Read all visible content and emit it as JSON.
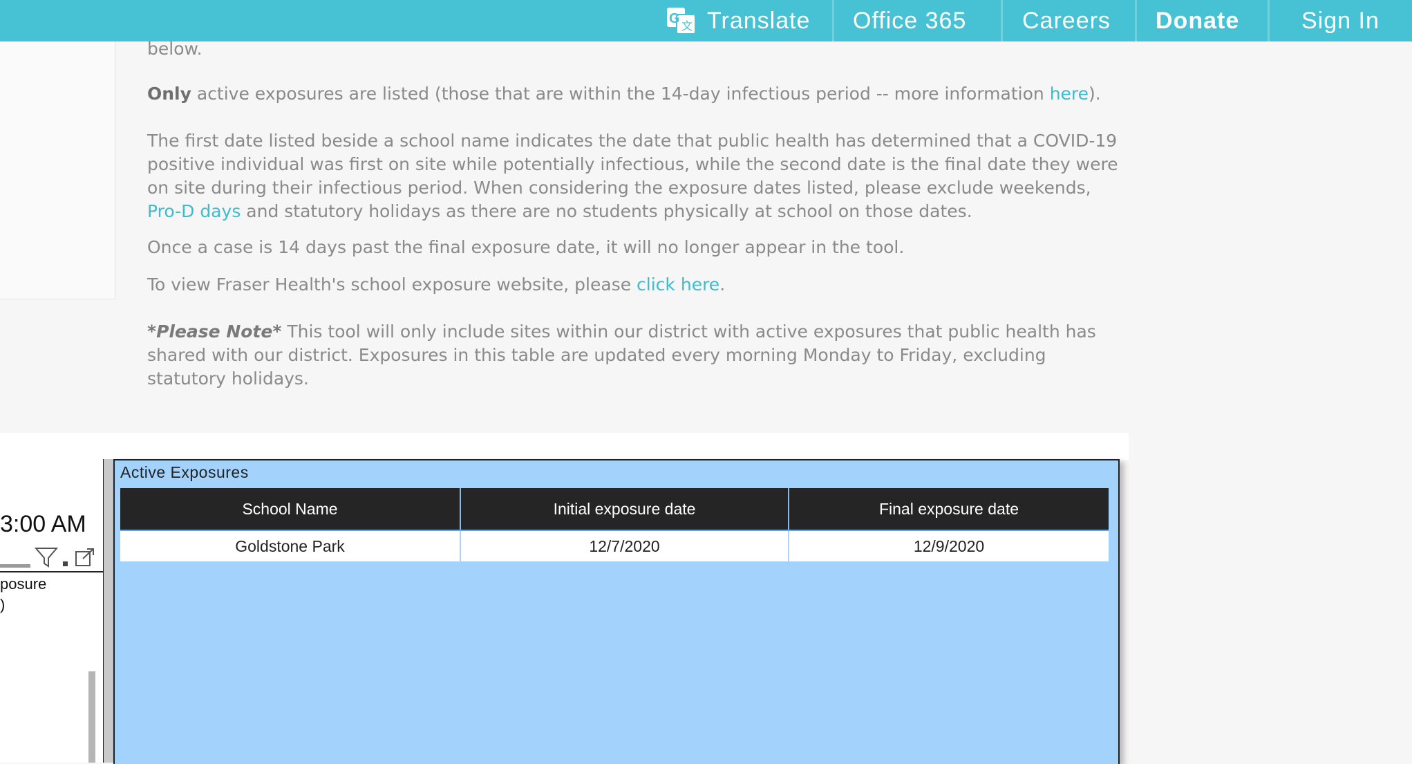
{
  "nav": {
    "translate": "Translate",
    "office365": "Office 365",
    "careers": "Careers",
    "donate": "Donate",
    "sign_in": "Sign In"
  },
  "intro": {
    "cutoff_text": "below.",
    "p1_bold": "Only",
    "p1_text": " active exposures are listed (those that are within the 14-day infectious period -- more information ",
    "p1_link": "here",
    "p1_end": ").",
    "p2_text": "The first date listed beside a school name indicates the date that public health has determined that a COVID-19 positive individual was first on site while potentially infectious, while the second date is the final date they were on site during their infectious period. When considering the exposure dates listed, please exclude weekends, ",
    "p2_link": "Pro-D days",
    "p2_end": " and statutory holidays as there are no students physically at school on those dates.",
    "p3_text": "Once a case is 14 days past the final exposure date, it will no longer appear in the tool.",
    "p4_text": "To view Fraser Health's school exposure website, please ",
    "p4_link": "click here",
    "p4_end": ".",
    "p5_bold": "*Please Note*",
    "p5_text": "  This tool will only include sites within our district with active exposures that public health has shared with our district. Exposures in this table are updated every morning Monday to Friday, excluding statutory holidays."
  },
  "left_visual": {
    "time": "3:00 AM",
    "posure_line1": "posure",
    "posure_line2": ")"
  },
  "report": {
    "title": "Active Exposures",
    "columns": [
      "School Name",
      "Initial exposure date",
      "Final exposure date"
    ],
    "rows": [
      [
        "Goldstone Park",
        "12/7/2020",
        "12/9/2020"
      ]
    ]
  },
  "colors": {
    "topbar": "#47c2d5",
    "link": "#3dbccd",
    "report_bg": "#a3d3fd",
    "header_bg": "#252525"
  }
}
